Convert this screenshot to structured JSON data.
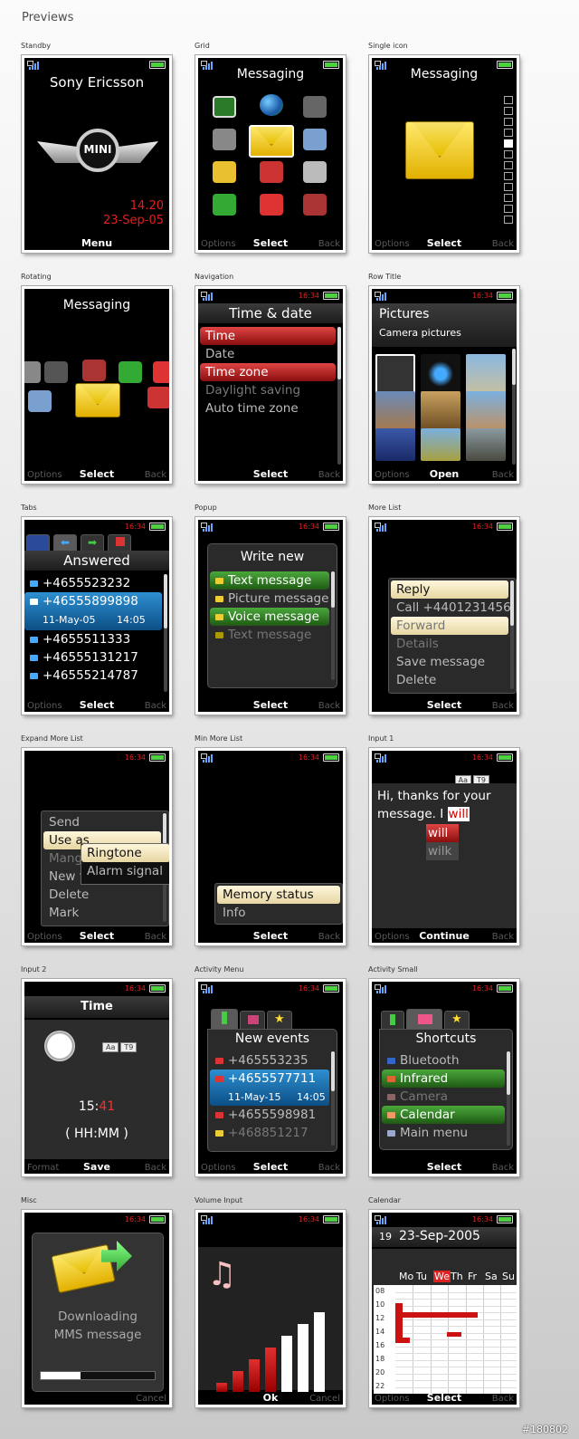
{
  "page_title": "Previews",
  "watermark": "#180802",
  "cells": [
    {
      "caption": "Standby",
      "brand": "Sony Ericsson",
      "logo_text": "MINI",
      "time": "14.20",
      "date": "23-Sep-05",
      "softkeys": {
        "left": "",
        "center": "Menu",
        "right": ""
      }
    },
    {
      "caption": "Grid",
      "title": "Messaging",
      "softkeys": {
        "left": "Options",
        "center": "Select",
        "right": "Back"
      }
    },
    {
      "caption": "Single icon",
      "title": "Messaging",
      "softkeys": {
        "left": "Options",
        "center": "Select",
        "right": "Back"
      }
    },
    {
      "caption": "Rotating",
      "title": "Messaging",
      "softkeys": {
        "left": "Options",
        "center": "Select",
        "right": "Back"
      }
    },
    {
      "caption": "Navigation",
      "clock": "16:34",
      "title": "Time & date",
      "items": [
        "Time",
        "Date",
        "Time zone",
        "Daylight saving",
        "Auto time zone"
      ],
      "softkeys": {
        "left": "",
        "center": "Select",
        "right": "Back"
      }
    },
    {
      "caption": "Row Title",
      "clock": "16:34",
      "title": "Pictures",
      "subtitle": "Camera pictures",
      "softkeys": {
        "left": "Options",
        "center": "Open",
        "right": "Back"
      }
    },
    {
      "caption": "Tabs",
      "clock": "16:34",
      "title": "Answered",
      "items": [
        "+4655523232",
        "+46555899898",
        "+4655511333",
        "+46555131217",
        "+46555214787"
      ],
      "detail_date": "11-May-05",
      "detail_time": "14:05",
      "softkeys": {
        "left": "Options",
        "center": "Select",
        "right": "Back"
      }
    },
    {
      "caption": "Popup",
      "clock": "16:34",
      "title": "Write new",
      "items": [
        "Text message",
        "Picture message",
        "Voice message",
        "Text message"
      ],
      "softkeys": {
        "left": "",
        "center": "Select",
        "right": "Back"
      }
    },
    {
      "caption": "More List",
      "clock": "16:34",
      "items": [
        "Reply",
        "Call +4401231456",
        "Forward",
        "Details",
        "Save message",
        "Delete"
      ],
      "softkeys": {
        "left": "",
        "center": "Select",
        "right": "Back"
      }
    },
    {
      "caption": "Expand More List",
      "clock": "16:34",
      "items": [
        "Send",
        "Use as",
        "Mang",
        "New f",
        "Delete",
        "Mark"
      ],
      "sub_items": [
        "Ringtone",
        "Alarm signal"
      ],
      "softkeys": {
        "left": "Options",
        "center": "Select",
        "right": "Back"
      }
    },
    {
      "caption": "Min More List",
      "clock": "16:34",
      "items": [
        "Memory status",
        "Info"
      ],
      "softkeys": {
        "left": "",
        "center": "Select",
        "right": "Back"
      }
    },
    {
      "caption": "Input 1",
      "clock": "16:34",
      "badge1": "Aa",
      "badge2": "T9",
      "text": "Hi, thanks for your message. I",
      "word": "will",
      "suggestions": [
        "will",
        "wilk"
      ],
      "softkeys": {
        "left": "Options",
        "center": "Continue",
        "right": "Back"
      }
    },
    {
      "caption": "Input 2",
      "clock": "16:34",
      "title": "Time",
      "badge1": "Aa",
      "badge2": "T9",
      "value_a": "15:",
      "value_b": "41",
      "format": "( HH:MM )",
      "softkeys": {
        "left": "Format",
        "center": "Save",
        "right": "Back"
      }
    },
    {
      "caption": "Activity Menu",
      "clock": "16:34",
      "title": "New events",
      "items": [
        "+465553235",
        "+4655577711",
        "+4655598981",
        "+468851217"
      ],
      "detail_date": "11-May-15",
      "detail_time": "14:05",
      "softkeys": {
        "left": "Options",
        "center": "Select",
        "right": "Back"
      }
    },
    {
      "caption": "Activity Small",
      "clock": "16:34",
      "title": "Shortcuts",
      "items": [
        "Bluetooth",
        "Infrared",
        "Camera",
        "Calendar",
        "Main menu"
      ],
      "softkeys": {
        "left": "",
        "center": "Select",
        "right": "Back"
      }
    },
    {
      "caption": "Misc",
      "clock": "16:34",
      "line1": "Downloading",
      "line2": "MMS message",
      "progress": 0.35,
      "softkeys": {
        "left": "",
        "center": "",
        "right": "Cancel"
      }
    },
    {
      "caption": "Volume Input",
      "clock": "16:34",
      "volume": 0.57,
      "softkeys": {
        "left": "",
        "center": "Ok",
        "right": "Cancel"
      }
    },
    {
      "caption": "Calendar",
      "clock": "16:34",
      "day": "19",
      "date": "23-Sep-2005",
      "days": [
        "Mo",
        "Tu",
        "We",
        "Th",
        "Fr",
        "Sa",
        "Su"
      ],
      "hours": [
        "08",
        "10",
        "12",
        "14",
        "16",
        "18",
        "20",
        "22"
      ],
      "softkeys": {
        "left": "Options",
        "center": "Select",
        "right": "Back"
      }
    }
  ]
}
